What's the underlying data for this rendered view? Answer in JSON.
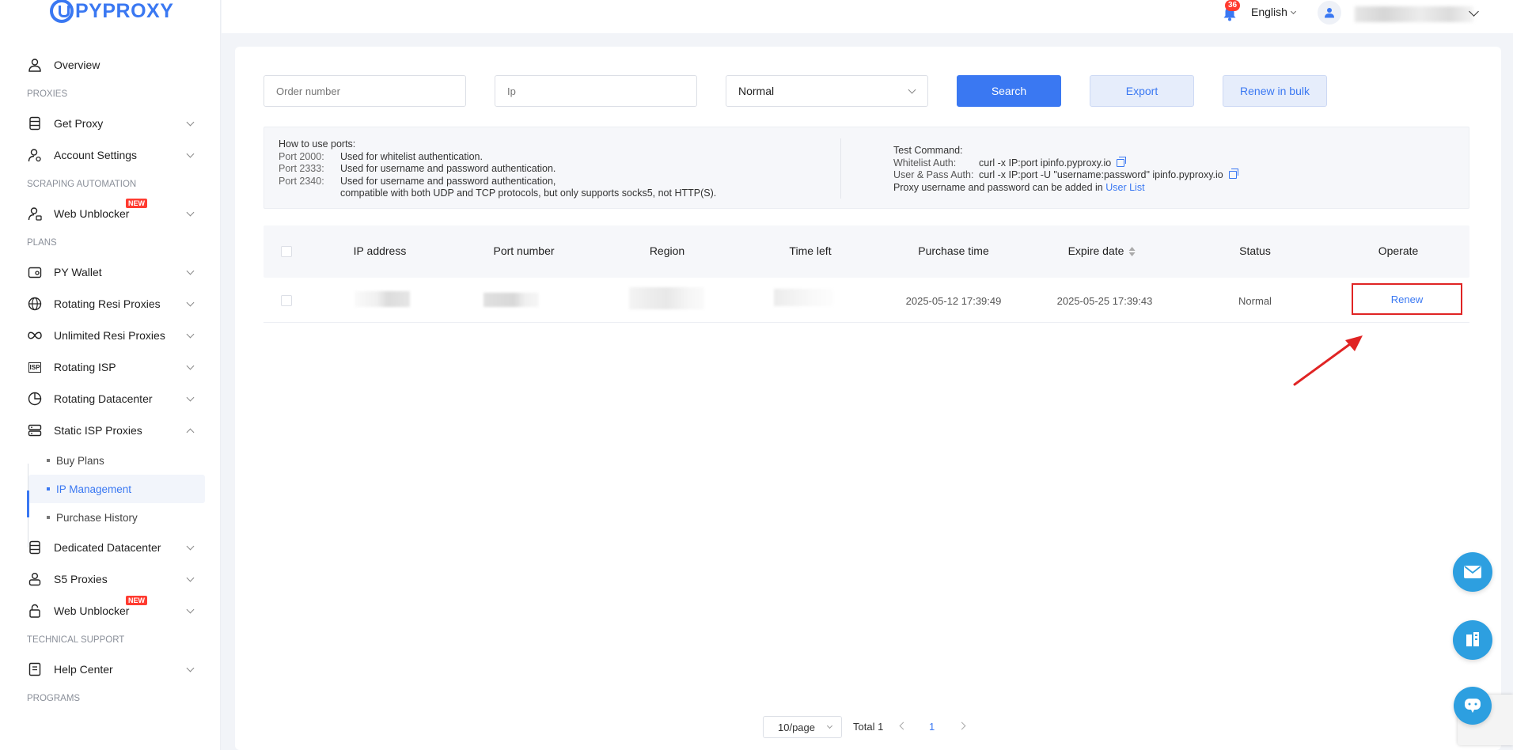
{
  "brand": {
    "logo_text": "PYPROXY"
  },
  "topbar": {
    "notifications_count": "36",
    "language": "English"
  },
  "sidebar": {
    "overview": "Overview",
    "sections": {
      "proxies": "PROXIES",
      "scraping": "SCRAPING AUTOMATION",
      "plans": "PLANS",
      "support": "TECHNICAL SUPPORT",
      "programs": "PROGRAMS"
    },
    "items": {
      "get_proxy": "Get Proxy",
      "account_settings": "Account Settings",
      "web_unblocker": "Web Unblocker",
      "py_wallet": "PY Wallet",
      "rotating_resi": "Rotating Resi Proxies",
      "unlimited_resi": "Unlimited Resi Proxies",
      "rotating_isp": "Rotating ISP",
      "rotating_dc": "Rotating Datacenter",
      "static_isp": "Static ISP Proxies",
      "dedicated_dc": "Dedicated Datacenter",
      "s5": "S5 Proxies",
      "web_unblocker_2": "Web Unblocker",
      "help_center": "Help Center"
    },
    "new_badge": "NEW",
    "isp_icon_text": "ISP",
    "static_isp_sub": {
      "buy_plans": "Buy Plans",
      "ip_management": "IP Management",
      "purchase_history": "Purchase History"
    }
  },
  "filters": {
    "order_placeholder": "Order number",
    "ip_placeholder": "Ip",
    "status_value": "Normal",
    "search": "Search",
    "export": "Export",
    "renew_bulk": "Renew in bulk"
  },
  "ports_info": {
    "title": "How to use ports:",
    "rows": [
      {
        "port": "Port 2000:",
        "desc": "Used for whitelist authentication."
      },
      {
        "port": "Port 2333:",
        "desc": "Used for username and password authentication."
      },
      {
        "port": "Port 2340:",
        "desc": "Used for username and password authentication,"
      }
    ],
    "extra": "compatible with both UDP and TCP protocols, but only supports socks5, not HTTP(S).",
    "test_title": "Test Command:",
    "whitelist_label": "Whitelist Auth:",
    "whitelist_cmd": "curl -x IP:port ipinfo.pyproxy.io",
    "userpass_label": "User & Pass Auth:",
    "userpass_cmd": "curl -x IP:port -U \"username:password\" ipinfo.pyproxy.io",
    "note": "Proxy username and password can be added in",
    "note_link": "User List"
  },
  "table": {
    "headers": {
      "ip": "IP address",
      "port": "Port number",
      "region": "Region",
      "time_left": "Time left",
      "purchase": "Purchase time",
      "expire": "Expire date",
      "status": "Status",
      "operate": "Operate"
    },
    "rows": [
      {
        "purchase_time": "2025-05-12 17:39:49",
        "expire_date": "2025-05-25 17:39:43",
        "status": "Normal",
        "action": "Renew"
      }
    ]
  },
  "pagination": {
    "page_size": "10/page",
    "total": "Total 1",
    "current": "1"
  },
  "colors": {
    "accent": "#3a78f2",
    "highlight": "#e02424",
    "fab": "#2d9fe0"
  }
}
